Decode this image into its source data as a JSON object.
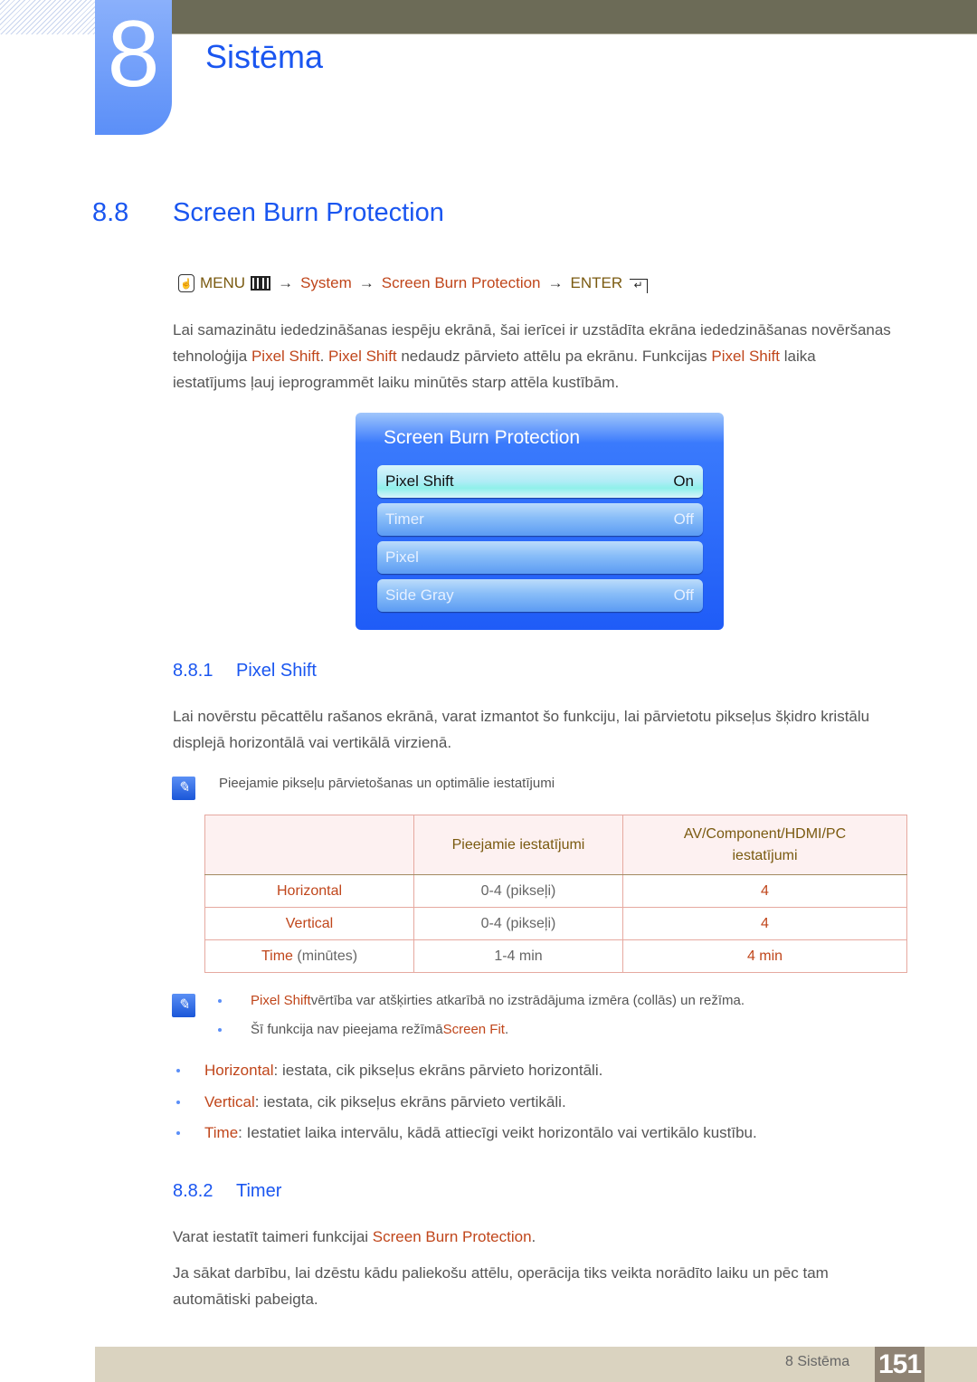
{
  "chapter": {
    "number": "8",
    "title": "Sistēma"
  },
  "section": {
    "number": "8.8",
    "title": "Screen Burn Protection"
  },
  "menu_path": {
    "menu_label": "MENU",
    "steps": [
      "System",
      "Screen Burn Protection"
    ],
    "enter_label": "ENTER",
    "arrow": "→"
  },
  "intro": {
    "line1": "Lai samazinātu iededzināšanas iespēju ekrānā, šai ierīcei ir uzstādīta ekrāna iededzināšanas novēršanas",
    "line2_a": "tehnoloģija ",
    "line2_hl1": "Pixel Shift",
    "line2_b": ". ",
    "line2_hl2": "Pixel Shift",
    "line2_c": " nedaudz pārvieto attēlu pa ekrānu. Funkcijas ",
    "line2_hl3": "Pixel Shift",
    "line2_d": " laika",
    "line3": "iestatījums ļauj ieprogrammēt laiku minūtēs starp attēla kustībām."
  },
  "osd": {
    "title": "Screen Burn Protection",
    "items": [
      {
        "label": "Pixel Shift",
        "value": "On",
        "active": true
      },
      {
        "label": "Timer",
        "value": "Off",
        "active": false
      },
      {
        "label": "Pixel",
        "value": "",
        "active": false
      },
      {
        "label": "Side Gray",
        "value": "Off",
        "active": false
      }
    ]
  },
  "pixel_shift": {
    "number": "8.8.1",
    "title": "Pixel Shift",
    "para_line1": "Lai novērstu pēcattēlu rašanos ekrānā, varat izmantot šo funkciju, lai pārvietotu pikseļus šķidro kristālu",
    "para_line2": "displejā horizontālā vai vertikālā virzienā.",
    "note": "Pieejamie pikseļu pārvietošanas un optimālie iestatījumi",
    "table": {
      "headers": [
        "",
        "Pieejamie iestatījumi",
        "AV/Component/HDMI/PC",
        "iestatījumi"
      ],
      "rows": [
        {
          "label": "Horizontal",
          "label_suffix": "",
          "range": "0-4 (pikseļi)",
          "optimal": "4"
        },
        {
          "label": "Vertical",
          "label_suffix": "",
          "range": "0-4 (pikseļi)",
          "optimal": "4"
        },
        {
          "label": "Time",
          "label_suffix": " (minūtes)",
          "range": "1-4 min",
          "optimal": "4 min"
        }
      ]
    },
    "notes": [
      {
        "hl": "Pixel Shift",
        "text": " vērtība var atšķirties atkarībā no izstrādājuma izmēra (collās) un režīma.",
        "pre": "",
        "post": ""
      },
      {
        "pre": "Šī funkcija nav pieejama režīmā ",
        "hl": "Screen Fit",
        "post": "."
      }
    ],
    "bullets": [
      {
        "term": "Horizontal",
        "text": ": iestata, cik pikseļus ekrāns pārvieto horizontāli."
      },
      {
        "term": "Vertical",
        "text": ": iestata, cik pikseļus ekrāns pārvieto vertikāli."
      },
      {
        "term": "Time",
        "text": ": Iestatiet laika intervālu, kādā attiecīgi veikt horizontālo vai vertikālo kustību."
      }
    ]
  },
  "timer": {
    "number": "8.8.2",
    "title": "Timer",
    "para1_pre": "Varat iestatīt taimeri funkcijai ",
    "para1_hl": "Screen Burn Protection",
    "para1_post": ".",
    "para2_line1": "Ja sākat darbību, lai dzēstu kādu paliekošu attēlu, operācija tiks veikta norādīto laiku un pēc tam",
    "para2_line2": "automātiski pabeigta."
  },
  "footer": {
    "chapter_label": "8 Sistēma",
    "page": "151"
  }
}
